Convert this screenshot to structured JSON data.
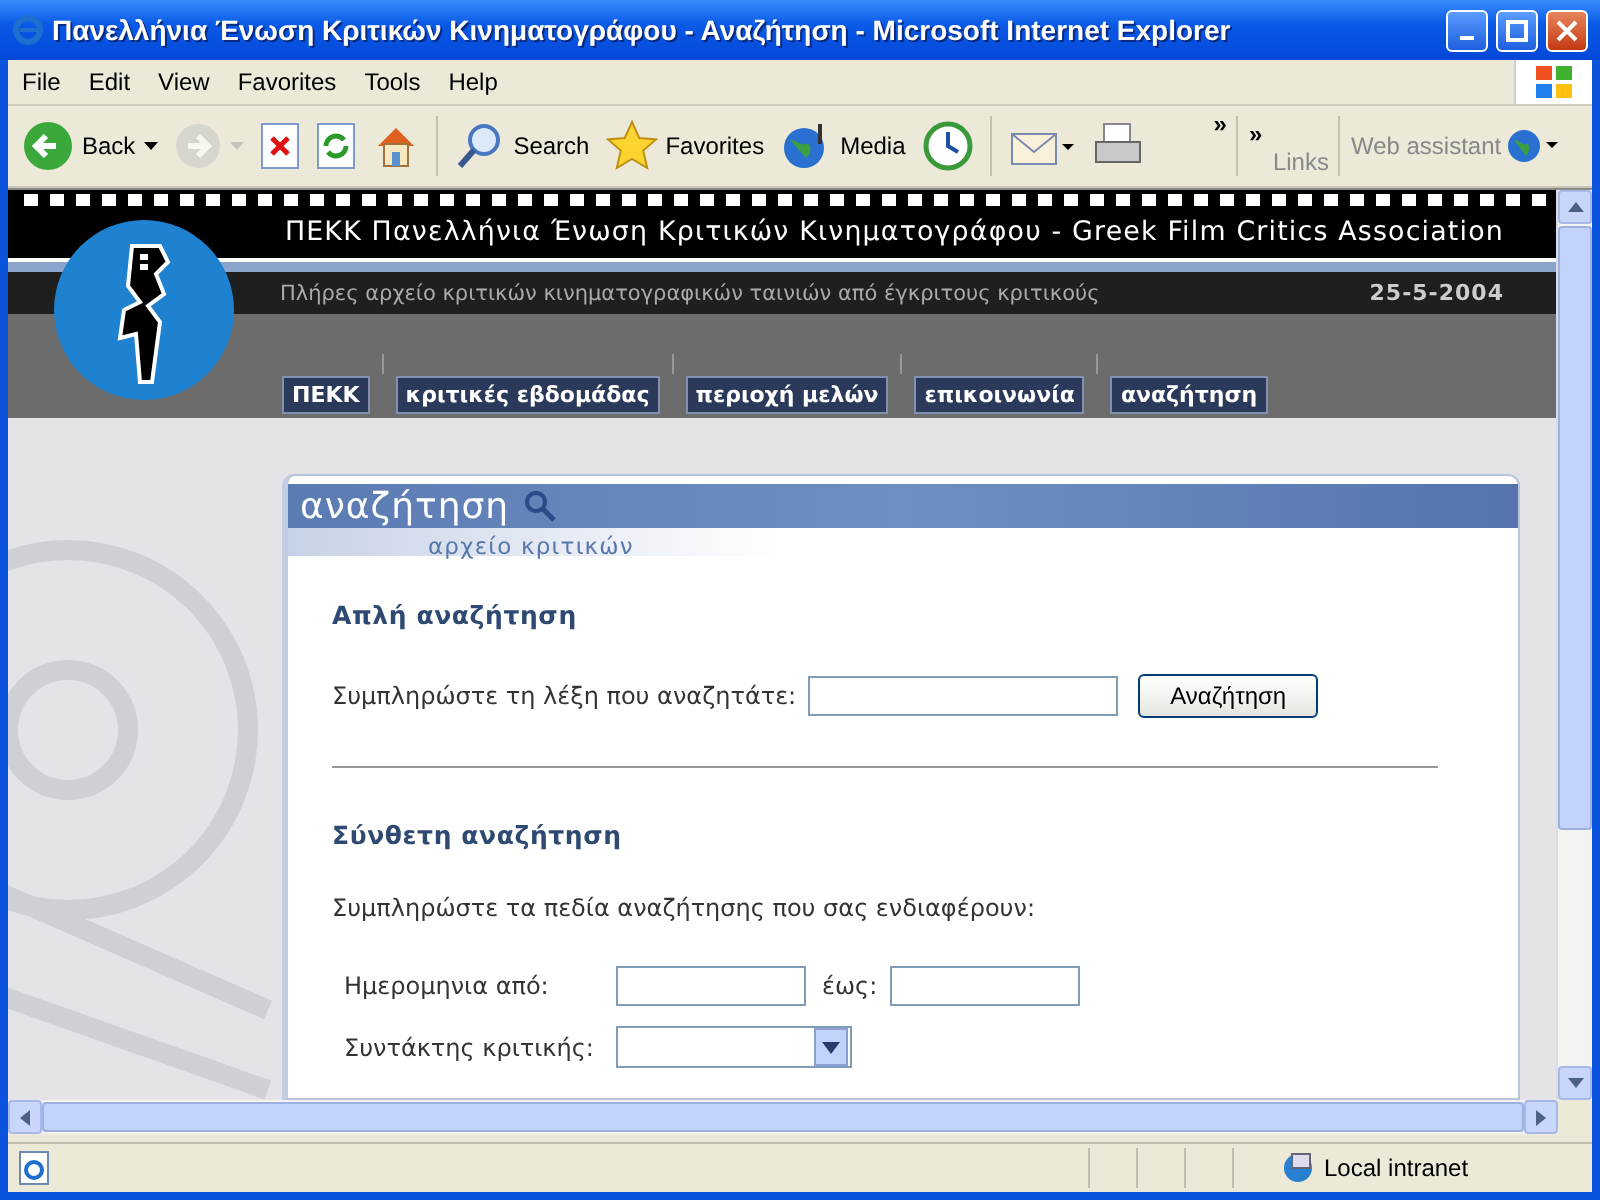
{
  "window": {
    "title": "Πανελλήνια Ένωση Κριτικών Κινηματογράφου - Αναζήτηση - Microsoft Internet Explorer"
  },
  "menu": [
    "File",
    "Edit",
    "View",
    "Favorites",
    "Tools",
    "Help"
  ],
  "toolbar": [
    {
      "kind": "back",
      "label": "Back",
      "disabled": false
    },
    {
      "kind": "forward",
      "disabled": true
    },
    {
      "kind": "stop",
      "disabled": false
    },
    {
      "kind": "refresh",
      "disabled": false
    },
    {
      "kind": "home",
      "disabled": false
    },
    {
      "kind": "search",
      "label": "Search",
      "disabled": false
    },
    {
      "kind": "favorites",
      "label": "Favorites",
      "disabled": false
    },
    {
      "kind": "media",
      "label": "Media",
      "disabled": false
    },
    {
      "kind": "history",
      "disabled": false
    },
    {
      "kind": "mail",
      "disabled": false
    },
    {
      "kind": "print",
      "disabled": false
    }
  ],
  "toolbar_more": "»",
  "links": {
    "chevron": "»",
    "label": "Links"
  },
  "assistant": {
    "label": "Web assistant"
  },
  "site": {
    "title": "ΠΕΚΚ Πανελλήνια Ένωση Κριτικών Κινηματογράφου - Greek Film Critics Association",
    "subtitle": "Πλήρες αρχείο κριτικών κινηματογραφικών ταινιών από έγκριτους κριτικούς",
    "date": "25-5-2004",
    "nav": [
      "ΠΕΚΚ",
      "κριτικές εβδομάδας",
      "περιοχή μελών",
      "επικοινωνία",
      "αναζήτηση"
    ]
  },
  "panel": {
    "title": "αναζήτηση",
    "subtitle": "αρχείο κριτικών",
    "simple": {
      "heading": "Απλή αναζήτηση",
      "label": "Συμπληρώστε τη λέξη που αναζητάτε:",
      "button": "Αναζήτηση"
    },
    "advanced": {
      "heading": "Σύνθετη αναζήτηση",
      "intro": "Συμπληρώστε τα πεδία αναζήτησης που σας ενδιαφέρουν:",
      "date_from": "Ημερομηνια από:",
      "date_to": "έως:",
      "author": "Συντάκτης κριτικής:"
    }
  },
  "status_bar": {
    "zone": "Local intranet"
  }
}
